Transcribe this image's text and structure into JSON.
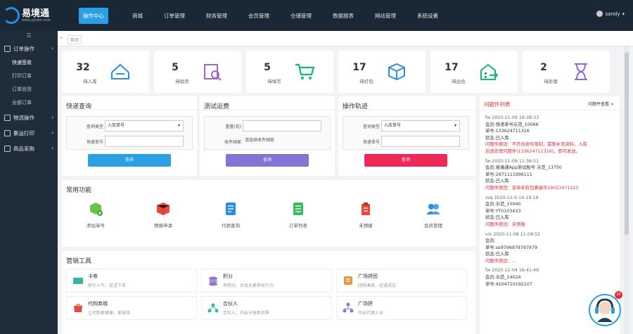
{
  "app": {
    "logo_text": "易境通",
    "logo_sub": "www.yjtoon.com",
    "logo_mark": "®"
  },
  "nav": {
    "items": [
      {
        "label": "操作中心",
        "active": true
      },
      {
        "label": "商城"
      },
      {
        "label": "订单管理"
      },
      {
        "label": "财务管理"
      },
      {
        "label": "会员管理"
      },
      {
        "label": "仓储管理"
      },
      {
        "label": "数据报表"
      },
      {
        "label": "网站管理"
      },
      {
        "label": "系统设置"
      }
    ],
    "user": "sandy"
  },
  "sidebar": {
    "toggle": "☰",
    "groups": [
      {
        "label": "订单操作",
        "expanded": true,
        "items": [
          "快速签收",
          "打印订单",
          "订单验货",
          "全部订单"
        ]
      },
      {
        "label": "物流操作"
      },
      {
        "label": "集运打印"
      },
      {
        "label": "商品采购"
      }
    ]
  },
  "tabs": {
    "home": "首页"
  },
  "stats": [
    {
      "value": "32",
      "label": "待入库",
      "color": "#2b8fe0",
      "icon": "inbox-icon"
    },
    {
      "value": "5",
      "label": "待验货",
      "color": "#9a6bc6",
      "icon": "inspect-icon"
    },
    {
      "value": "5",
      "label": "待填写",
      "color": "#13b87a",
      "icon": "cart-icon"
    },
    {
      "value": "17",
      "label": "待打包",
      "color": "#2b8fe0",
      "icon": "box-icon"
    },
    {
      "value": "17",
      "label": "待出仓",
      "color": "#13b87a",
      "icon": "warehouse-out-icon"
    },
    {
      "value": "2",
      "label": "待处理",
      "color": "#8a6ad6",
      "icon": "hourglass-icon"
    }
  ],
  "panels": {
    "express_query": {
      "title": "快递查询",
      "type_label": "查询类型",
      "type_value": "入库单号",
      "num_label": "快递单号",
      "button": "查询",
      "button_color": "#2b9fe4"
    },
    "freight": {
      "title": "测试运费",
      "weight_label": "重量(克)",
      "dest_label": "收件国家",
      "dest_value": "请选择收件国家",
      "button": "查询",
      "button_color": "#8673d6"
    },
    "operate": {
      "title": "操作轨迹",
      "type_label": "查询类型",
      "type_value": "入库单号",
      "num_label": "快递单号",
      "button": "查询",
      "button_color": "#f0285a"
    }
  },
  "quick": {
    "title": "常用功能",
    "items": [
      {
        "label": "添加单号",
        "icon": "add-package-icon",
        "color": "#6cc24a"
      },
      {
        "label": "预报申请",
        "icon": "box-icon",
        "color": "#e8493a"
      },
      {
        "label": "代收查询",
        "icon": "receipt-icon",
        "color": "#2b8fe0"
      },
      {
        "label": "订单列表",
        "icon": "list-icon",
        "color": "#3dba5f"
      },
      {
        "label": "未预报",
        "icon": "clipboard-icon",
        "color": "#e8493a"
      },
      {
        "label": "会员管理",
        "icon": "users-icon",
        "color": "#2b8fe0"
      }
    ]
  },
  "marketing": {
    "title": "营销工具",
    "items": [
      {
        "title": "卡劵",
        "desc": "吸引人气，促进下单",
        "color": "#36b6a2",
        "icon": "coupon-icon"
      },
      {
        "title": "积分",
        "desc": "有积分，对会员更有吸引力",
        "color": "#8c73d6",
        "icon": "points-icon"
      },
      {
        "title": "广场拼团",
        "desc": "团购凑单，促进成交",
        "color": "#e8963a",
        "icon": "group-buy-icon"
      },
      {
        "title": "代购商城",
        "desc": "让代购更便捷，更省钱",
        "color": "#e8493a",
        "icon": "mall-icon"
      },
      {
        "title": "合伙人",
        "desc": "合伙人，开启分享新世界",
        "color": "#36b6a2",
        "icon": "partner-icon"
      },
      {
        "title": "广场拼",
        "desc": "开启代理人业",
        "color": "#8c73d6",
        "icon": "share-icon"
      }
    ]
  },
  "issues": {
    "title": "问题件列表",
    "more": "问题件查看 >",
    "lines": [
      {
        "text": "fw 2020-11-09 16:38:33",
        "style": "gray"
      },
      {
        "text": "会员:快递单号示范_10066",
        "style": ""
      },
      {
        "text": "单号:133624711316",
        "style": ""
      },
      {
        "text": "状态:已入库",
        "style": ""
      },
      {
        "text": "问题件原因：不符合收件限制，需要补充资料，入库",
        "style": "red"
      },
      {
        "text": "后请处理问题件(133624711316)，即可发送。",
        "style": "red"
      },
      {
        "text": "",
        "style": ""
      },
      {
        "text": "fw 2020-11-09 11:36:51",
        "style": "gray"
      },
      {
        "text": "会员:易境通App测试账号 示范_13750",
        "style": ""
      },
      {
        "text": "单号:2971111996111",
        "style": ""
      },
      {
        "text": "状态:已入库",
        "style": ""
      },
      {
        "text": "问题件原因：该单未有包裹编号19023471313",
        "style": "red"
      },
      {
        "text": "",
        "style": ""
      },
      {
        "text": "zsq 2020-11-0 14:19:19",
        "style": "gray"
      },
      {
        "text": "会员:示范_10040",
        "style": ""
      },
      {
        "text": "单号:YT0103433",
        "style": ""
      },
      {
        "text": "状态:已入库",
        "style": ""
      },
      {
        "text": "问题件原因：未预报",
        "style": "red"
      },
      {
        "text": "",
        "style": ""
      },
      {
        "text": "vix 2020-11-08 11:08:52",
        "style": "gray"
      },
      {
        "text": "会员:",
        "style": ""
      },
      {
        "text": "单号:se9796979797979",
        "style": ""
      },
      {
        "text": "状态:已入库",
        "style": ""
      },
      {
        "text": "问题件原因：...",
        "style": "red"
      },
      {
        "text": "",
        "style": ""
      },
      {
        "text": "fw 2020-12-04 16:41:49",
        "style": "gray"
      },
      {
        "text": "会员:示范_14024",
        "style": ""
      },
      {
        "text": "单号:4104710192107",
        "style": ""
      }
    ]
  },
  "service_badge": "20"
}
